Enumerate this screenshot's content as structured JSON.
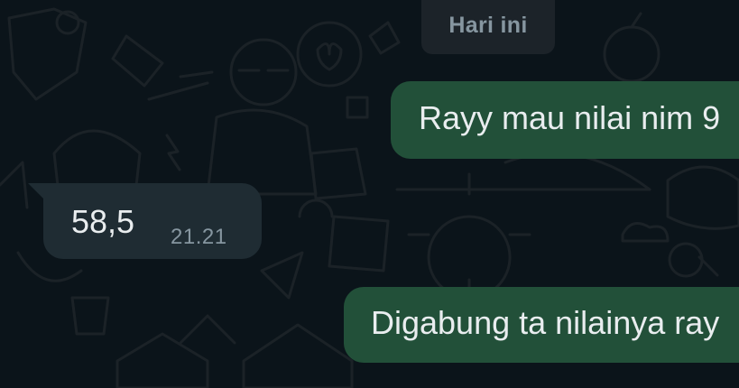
{
  "date_separator": "Hari ini",
  "messages": [
    {
      "direction": "outgoing",
      "text": "Rayy mau nilai nim 9"
    },
    {
      "direction": "incoming",
      "text": "58,5",
      "time": "21.21"
    },
    {
      "direction": "outgoing",
      "text": "Digabung ta nilainya ray"
    }
  ],
  "colors": {
    "background": "#0b141a",
    "outgoing_bubble": "#225039",
    "incoming_bubble": "#1f2c33",
    "date_chip": "#1c2329",
    "primary_text": "#e9edef",
    "secondary_text": "#8696a0"
  }
}
